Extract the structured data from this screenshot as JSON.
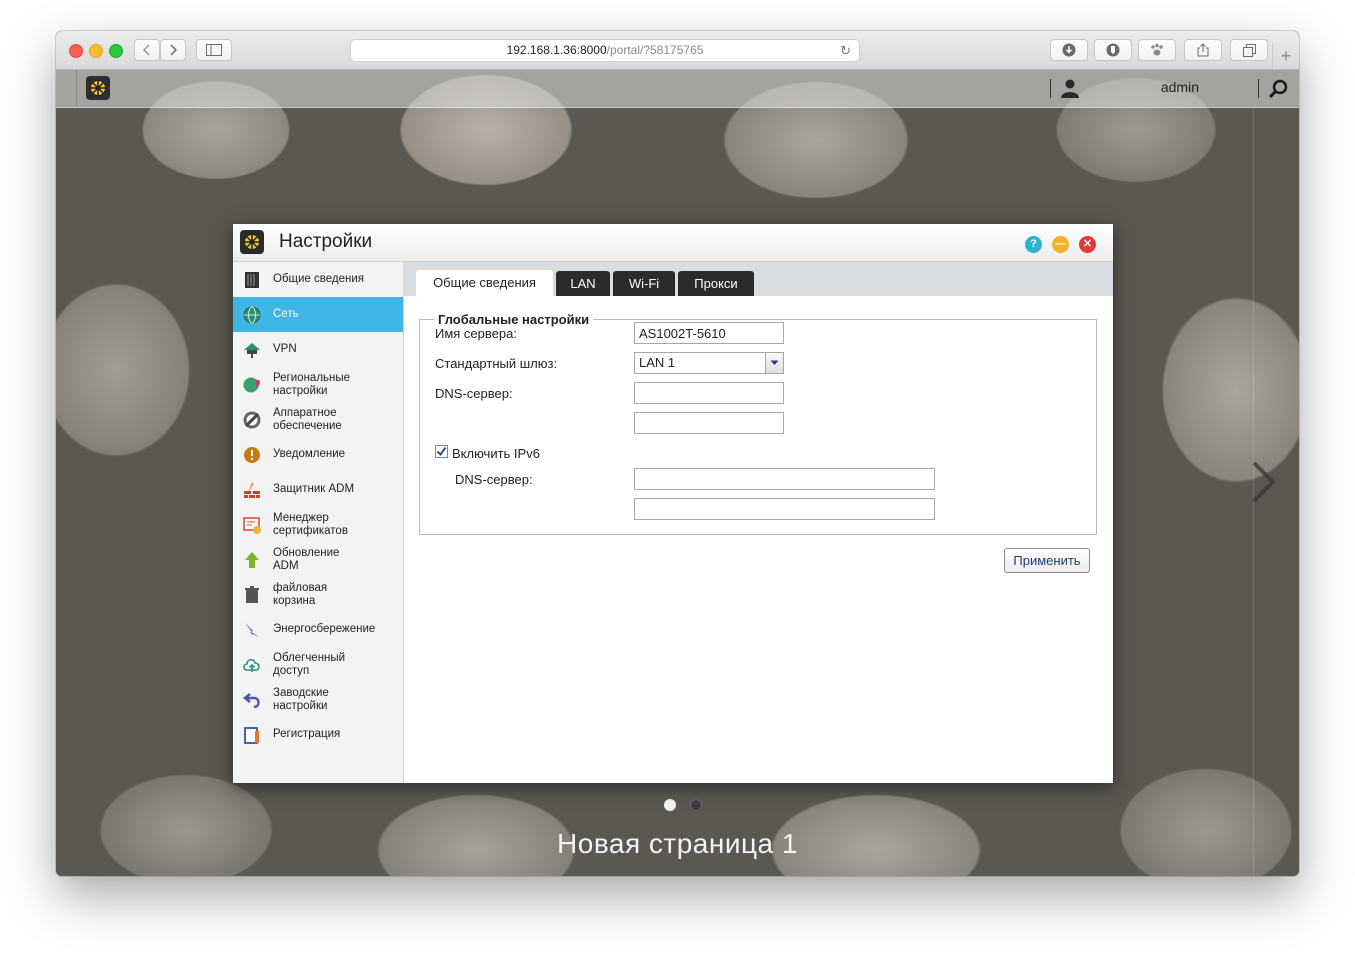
{
  "browser": {
    "url_host": "192.168.1.36:8000",
    "url_path": "/portal/?58175765",
    "new_tab_glyph": "+"
  },
  "adm": {
    "username": "admin",
    "page_name": "Новая страница 1"
  },
  "dialog": {
    "title": "Настройки",
    "sidebar": [
      {
        "label": "Общие сведения",
        "icon": "server-icon"
      },
      {
        "label": "Сеть",
        "icon": "globe-icon",
        "active": true
      },
      {
        "label": "VPN",
        "icon": "vpn-icon"
      },
      {
        "label": "Региональные настройки",
        "icon": "region-icon"
      },
      {
        "label": "Аппаратное обеспечение",
        "icon": "hardware-icon"
      },
      {
        "label": "Уведомление",
        "icon": "alert-icon"
      },
      {
        "label": "Защитник ADM",
        "icon": "firewall-icon"
      },
      {
        "label": "Менеджер сертификатов",
        "icon": "certificate-icon"
      },
      {
        "label": "Обновление ADM",
        "icon": "update-arrow-icon"
      },
      {
        "label": "файловая корзина",
        "icon": "trash-icon"
      },
      {
        "label": "Энергосбережение",
        "icon": "energy-icon"
      },
      {
        "label": "Облегченный доступ",
        "icon": "cloud-icon"
      },
      {
        "label": "Заводские настройки",
        "icon": "reset-icon"
      },
      {
        "label": "Регистрация",
        "icon": "registration-icon"
      }
    ],
    "tabs": [
      "Общие сведения",
      "LAN",
      "Wi-Fi",
      "Прокси"
    ],
    "form": {
      "legend": "Глобальные настройки",
      "server_name_label": "Имя сервера:",
      "server_name_value": "AS1002T-5610",
      "gateway_label": "Стандартный шлюз:",
      "gateway_value": "LAN 1",
      "dns_label": "DNS-сервер:",
      "dns1_value": "",
      "dns2_value": "",
      "ipv6_label": "Включить IPv6",
      "ipv6_checked": true,
      "ipv6_dns_label": "DNS-сервер:",
      "ipv6_dns1_value": "",
      "ipv6_dns2_value": ""
    },
    "apply_label": "Применить"
  },
  "colors": {
    "accent": "#3fb4e6",
    "tab_dark": "#2b2b2b",
    "close": "#e4393a",
    "minimize": "#f0b32a",
    "help": "#2fb3d0"
  }
}
